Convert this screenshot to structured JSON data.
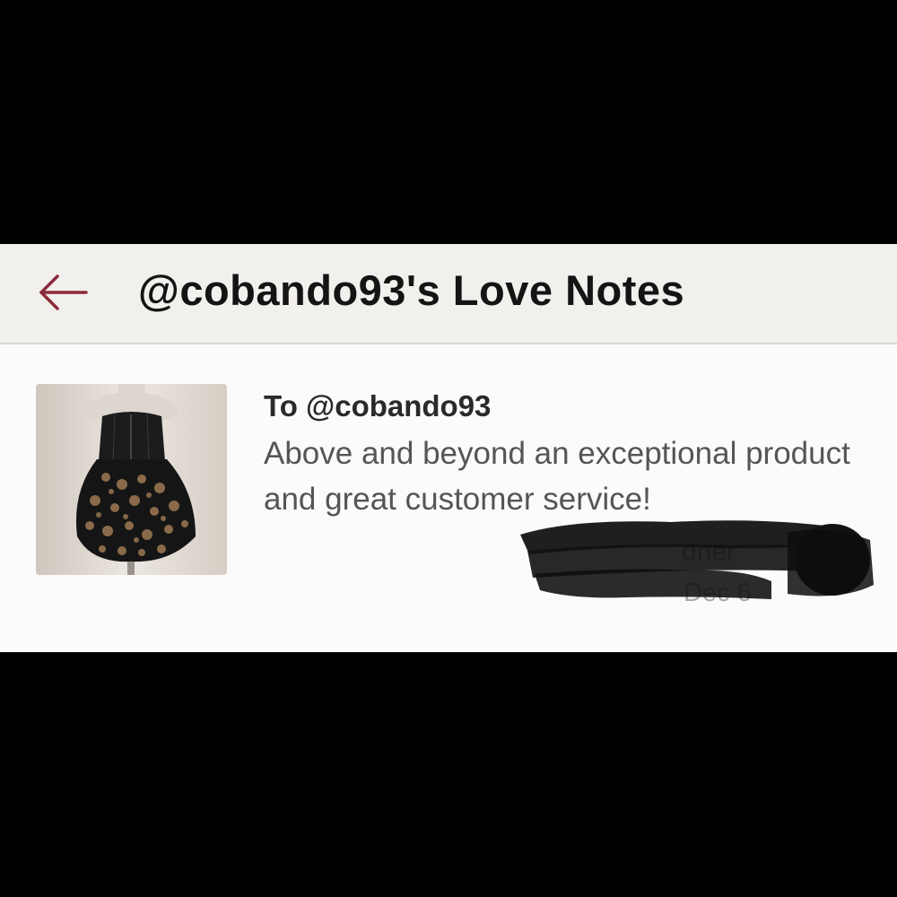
{
  "header": {
    "back_icon": "arrow-left-icon",
    "title": "@cobando93's Love Notes"
  },
  "note": {
    "to": "To @cobando93",
    "message": "Above and beyond an exceptional product and great customer service!",
    "signer_partial": "dner",
    "date": "Dec 6",
    "thumbnail_icon": "dress-photo"
  },
  "colors": {
    "accent": "#8b2a3a",
    "header_bg": "#f2f0ed",
    "body_bg": "#fbfbfb",
    "title_text": "#141414",
    "message_text": "#555555"
  }
}
